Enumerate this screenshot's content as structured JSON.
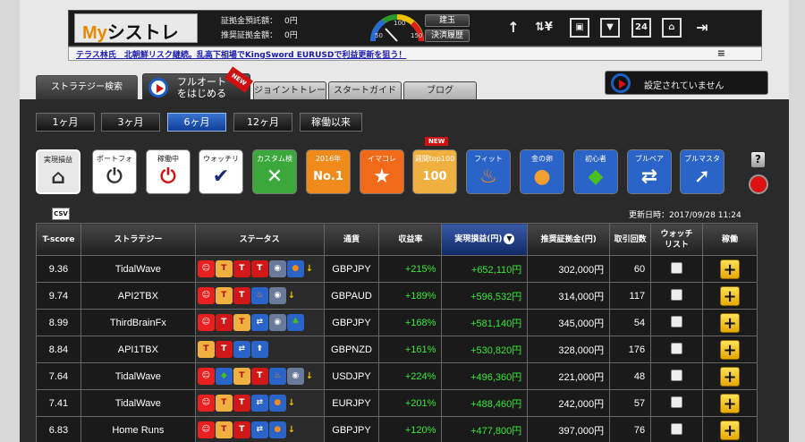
{
  "header": {
    "logo_prefix": "My",
    "logo_main": "シストレ",
    "logo_suffix": "24",
    "deposit_label": "証拠金預託額",
    "deposit_value": "0円",
    "recommended_label": "推奨証拠金額",
    "recommended_value": "0円",
    "gauge_min": "50",
    "gauge_mid": "100",
    "gauge_max": "150",
    "btn_position": "建玉",
    "btn_history": "決済履歴"
  },
  "nav_icons": [
    "arrow-up-icon",
    "exchange-icon",
    "screen-person-icon",
    "screen-down-icon",
    "calendar-24-icon",
    "home-icon",
    "logout-icon"
  ],
  "nav_labels": {
    "calendar": "24"
  },
  "ticker": {
    "text": "テラス林氏　北朝鮮リスク継続。乱高下相場でKingSword EURUSDで利益更新を狙う！",
    "menu": "≡"
  },
  "tabs": {
    "strategy_search": "ストラテジー検索",
    "full_auto": "フルオート\nをはじめる",
    "full_auto_line1": "フルオート",
    "full_auto_line2": "をはじめる",
    "full_auto_badge": "NEW",
    "joint_trade": "ジョイントトレード",
    "start_guide": "スタートガイド",
    "blog": "ブログ"
  },
  "settings_button": "設定されていません",
  "periods": [
    "1ヶ月",
    "3ヶ月",
    "6ヶ月",
    "12ヶ月",
    "稼働以来"
  ],
  "active_period": 2,
  "categories": [
    {
      "label": "実現損益",
      "glyph": "⌂",
      "bg": "#e8e8e8",
      "fg": "#333"
    },
    {
      "label": "ポートフォ",
      "glyph": "⏻",
      "bg": "#ffffff",
      "fg": "#333"
    },
    {
      "label": "稼働中",
      "glyph": "⏻",
      "bg": "#ffffff",
      "fg": "#d21212"
    },
    {
      "label": "ウォッチリ",
      "glyph": "✔",
      "bg": "#ffffff",
      "fg": "#1a2a7a"
    },
    {
      "label": "カスタム検",
      "glyph": "✕",
      "bg": "#3aa83a",
      "fg": "#fff"
    },
    {
      "label": "2016年",
      "glyph": "No.1",
      "bg": "#f08a1a",
      "fg": "#fff"
    },
    {
      "label": "イマコレ",
      "glyph": "★",
      "bg": "#f06a1a",
      "fg": "#fff"
    },
    {
      "label": "週間top100",
      "glyph": "100",
      "bg": "#f0b040",
      "fg": "#fff"
    },
    {
      "label": "フィット",
      "glyph": "♨",
      "bg": "#2a64c8",
      "fg": "#ff8a1a"
    },
    {
      "label": "金の卵",
      "glyph": "●",
      "bg": "#2a64c8",
      "fg": "#f0a030"
    },
    {
      "label": "初心者",
      "glyph": "◆",
      "bg": "#2a64c8",
      "fg": "#4ac020"
    },
    {
      "label": "ブルベア",
      "glyph": "⇄",
      "bg": "#2a64c8",
      "fg": "#fff"
    },
    {
      "label": "ブルマスタ",
      "glyph": "➚",
      "bg": "#2a64c8",
      "fg": "#fff"
    }
  ],
  "category_new_badge": "NEW",
  "help": "?",
  "csv": "CSV",
  "updated": "更新日時：2017/09/28 11:24",
  "table": {
    "headers": [
      "T-score",
      "ストラテジー",
      "ステータス",
      "通貨",
      "収益率",
      "実現損益(円)",
      "推奨証拠金(円)",
      "取引回数",
      "ウォッチ\nリスト",
      "稼働"
    ],
    "rows": [
      {
        "tscore": "9.36",
        "name": "TidalWave",
        "status": [
          "smile",
          "top100",
          "t100",
          "t100",
          "globe",
          "ball"
        ],
        "arrow": true,
        "pair": "GBPJPY",
        "rate": "+215%",
        "pnl": "+652,110円",
        "margin": "302,000円",
        "trades": "60"
      },
      {
        "tscore": "9.74",
        "name": "API2TBX",
        "status": [
          "smile",
          "top100",
          "t100",
          "fire",
          "globe"
        ],
        "arrow": true,
        "pair": "GBPAUD",
        "rate": "+189%",
        "pnl": "+596,532円",
        "margin": "314,000円",
        "trades": "117"
      },
      {
        "tscore": "8.99",
        "name": "ThirdBrainFx",
        "status": [
          "smile",
          "t100",
          "top100",
          "bull",
          "globe",
          "tree"
        ],
        "arrow": false,
        "pair": "GBPJPY",
        "rate": "+168%",
        "pnl": "+581,140円",
        "margin": "345,000円",
        "trades": "54"
      },
      {
        "tscore": "8.84",
        "name": "API1TBX",
        "status": [
          "top100",
          "t100",
          "bull",
          "arrowup"
        ],
        "arrow": false,
        "pair": "GBPNZD",
        "rate": "+161%",
        "pnl": "+530,820円",
        "margin": "328,000円",
        "trades": "176"
      },
      {
        "tscore": "7.64",
        "name": "TidalWave",
        "status": [
          "smile",
          "leaf",
          "top100",
          "t100",
          "fire",
          "globe"
        ],
        "arrow": true,
        "pair": "USDJPY",
        "rate": "+224%",
        "pnl": "+496,360円",
        "margin": "221,000円",
        "trades": "48"
      },
      {
        "tscore": "7.41",
        "name": "TidalWave",
        "status": [
          "smile",
          "top100",
          "t100",
          "bull",
          "ball"
        ],
        "arrow": true,
        "pair": "EURJPY",
        "rate": "+201%",
        "pnl": "+488,460円",
        "margin": "242,000円",
        "trades": "57"
      },
      {
        "tscore": "6.83",
        "name": "Home Runs",
        "status": [
          "smile",
          "top100",
          "t100",
          "bull",
          "ball"
        ],
        "arrow": true,
        "pair": "GBPJPY",
        "rate": "+120%",
        "pnl": "+477,800円",
        "margin": "397,000円",
        "trades": "76"
      }
    ],
    "add_label": "+"
  },
  "status_icon_styles": {
    "smile": {
      "bg": "#e82020",
      "fg": "#fff",
      "glyph": "☺"
    },
    "top100": {
      "bg": "#f0b040",
      "fg": "#b01010",
      "glyph": "T"
    },
    "t100": {
      "bg": "#d01818",
      "fg": "#fff",
      "glyph": "T"
    },
    "globe": {
      "bg": "#6a7a9a",
      "fg": "#fff",
      "glyph": "◉"
    },
    "ball": {
      "bg": "#2a64c8",
      "fg": "#f08a1a",
      "glyph": "●"
    },
    "fire": {
      "bg": "#2a64c8",
      "fg": "#ff8a1a",
      "glyph": "♨"
    },
    "bull": {
      "bg": "#2a64c8",
      "fg": "#fff",
      "glyph": "⇄"
    },
    "tree": {
      "bg": "#2a64c8",
      "fg": "#4ac020",
      "glyph": "♣"
    },
    "arrowup": {
      "bg": "#2a64c8",
      "fg": "#fff",
      "glyph": "⬆"
    },
    "leaf": {
      "bg": "#2a64c8",
      "fg": "#4ac020",
      "glyph": "◆"
    }
  },
  "colors": {
    "profit": "#38e838",
    "accent": "#1c5fc4",
    "active_tab": "#2f5fb8"
  }
}
